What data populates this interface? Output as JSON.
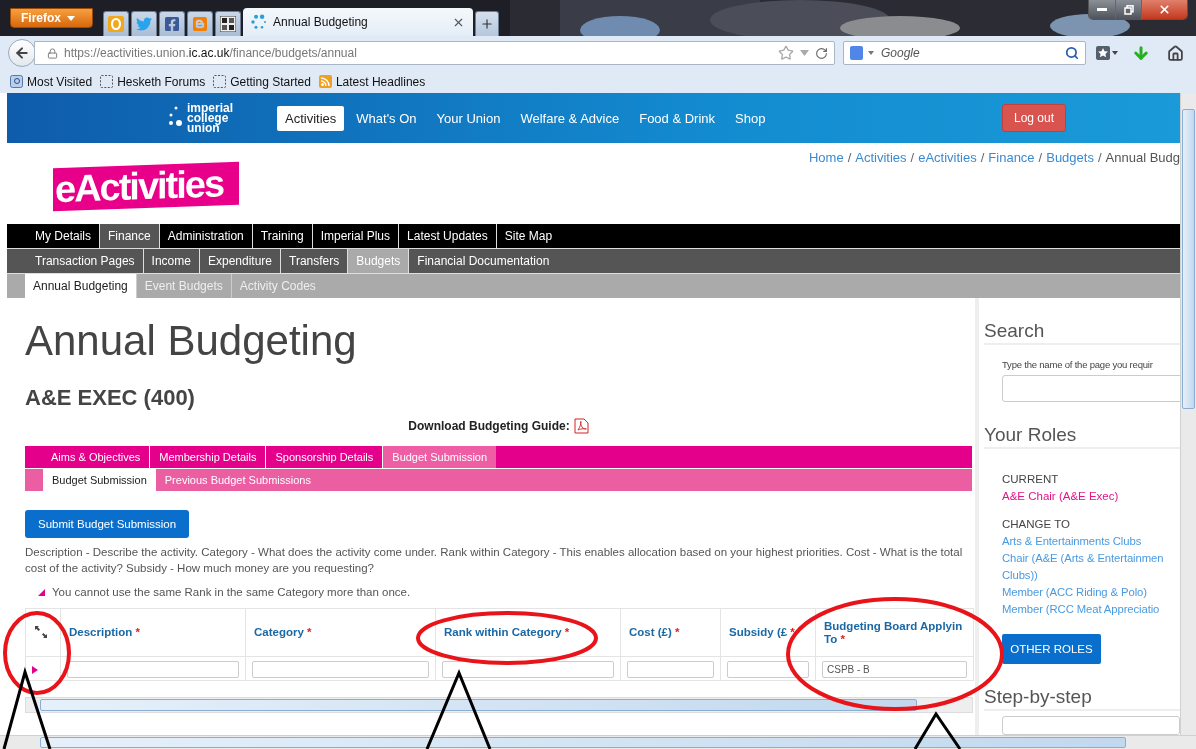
{
  "browser": {
    "app_button": "Firefox",
    "tab": {
      "title": "Annual Budgeting"
    },
    "url": {
      "scheme_host": "https://eactivities.union.",
      "domain": "ic.ac.uk",
      "path": "/finance/budgets/annual"
    },
    "search_placeholder": "Google",
    "bookmarks": [
      {
        "label": "Most Visited",
        "kind": "smart"
      },
      {
        "label": "Hesketh Forums",
        "kind": "page"
      },
      {
        "label": "Getting Started",
        "kind": "page"
      },
      {
        "label": "Latest Headlines",
        "kind": "feed"
      }
    ]
  },
  "site": {
    "logo_lines": [
      "imperial",
      "college",
      "union"
    ],
    "nav": [
      {
        "label": "Activities",
        "selected": true
      },
      {
        "label": "What's On",
        "selected": false
      },
      {
        "label": "Your Union",
        "selected": false
      },
      {
        "label": "Welfare & Advice",
        "selected": false
      },
      {
        "label": "Food & Drink",
        "selected": false
      },
      {
        "label": "Shop",
        "selected": false
      }
    ],
    "logout": "Log out",
    "breadcrumb_separator": "/",
    "breadcrumb": [
      {
        "label": "Home",
        "link": true
      },
      {
        "label": "Activities",
        "link": true
      },
      {
        "label": "eActivities",
        "link": true
      },
      {
        "label": "Finance",
        "link": true
      },
      {
        "label": "Budgets",
        "link": true
      },
      {
        "label": "Annual Budg",
        "link": false
      }
    ],
    "brand": "eActivities",
    "menu_levels": [
      {
        "items": [
          {
            "label": "My Details",
            "selected": false
          },
          {
            "label": "Finance",
            "selected": true
          },
          {
            "label": "Administration",
            "selected": false
          },
          {
            "label": "Training",
            "selected": false
          },
          {
            "label": "Imperial Plus",
            "selected": false
          },
          {
            "label": "Latest Updates",
            "selected": false
          },
          {
            "label": "Site Map",
            "selected": false
          }
        ]
      },
      {
        "items": [
          {
            "label": "Transaction Pages",
            "selected": false
          },
          {
            "label": "Income",
            "selected": false
          },
          {
            "label": "Expenditure",
            "selected": false
          },
          {
            "label": "Transfers",
            "selected": false
          },
          {
            "label": "Budgets",
            "selected": true
          },
          {
            "label": "Financial Documentation",
            "selected": false
          }
        ]
      },
      {
        "items": [
          {
            "label": "Annual Budgeting",
            "selected": true
          },
          {
            "label": "Event Budgets",
            "selected": false
          },
          {
            "label": "Activity Codes",
            "selected": false
          }
        ]
      }
    ]
  },
  "page": {
    "title": "Annual Budgeting",
    "group": "A&E EXEC (400)",
    "download_label": "Download Budgeting Guide:",
    "section_tabs": [
      {
        "label": "Aims & Objectives",
        "selected": false
      },
      {
        "label": "Membership Details",
        "selected": false
      },
      {
        "label": "Sponsorship Details",
        "selected": false
      },
      {
        "label": "Budget Submission",
        "selected": true
      }
    ],
    "sub_tabs": [
      {
        "label": "Budget Submission",
        "selected": true
      },
      {
        "label": "Previous Budget Submissions",
        "selected": false
      }
    ],
    "submit": "Submit Budget Submission",
    "description": "Description - Describe the activity. Category - What does the activity come under. Rank within Category - This enables allocation based on your highest priorities. Cost - What is the total cost of the activity? Subsidy - How much money are you requesting?",
    "warning": "You cannot use the same Rank in the same Category more than once.",
    "table": {
      "required_mark": "*",
      "columns": [
        {
          "label": [
            "Description"
          ],
          "required": true
        },
        {
          "label": [
            "Category"
          ],
          "required": true
        },
        {
          "label": [
            "Rank within Category"
          ],
          "required": true
        },
        {
          "label": [
            "Cost (£)"
          ],
          "required": true
        },
        {
          "label": [
            "Subsidy (£"
          ],
          "required": true
        },
        {
          "label": [
            "Budgeting Board Applyin",
            "To"
          ],
          "required": true,
          "value": "CSPB - B"
        }
      ]
    }
  },
  "sidebar": {
    "search": {
      "heading": "Search",
      "hint": "Type the name of the page you requir"
    },
    "roles": {
      "heading": "Your Roles",
      "current_label": "CURRENT",
      "current_role": "A&E Chair (A&E Exec)",
      "change_label": "CHANGE TO",
      "options": [
        "Arts & Entertainments Clubs",
        "Chair (A&E (Arts & Entertainmen",
        "Clubs))",
        "Member (ACC Riding & Polo)",
        "Member (RCC Meat Appreciatio"
      ],
      "button": "OTHER ROLES"
    },
    "step_heading": "Step-by-step"
  }
}
